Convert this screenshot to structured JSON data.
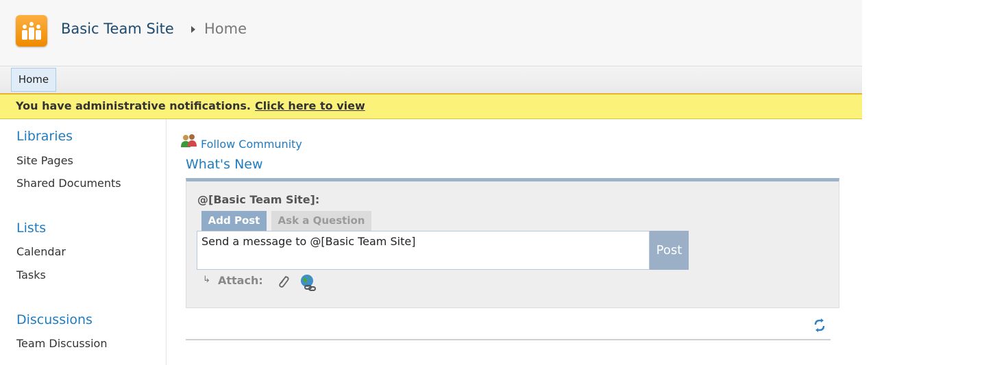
{
  "header": {
    "site_title": "Basic Team Site",
    "current_page": "Home"
  },
  "topnav": {
    "tabs": [
      {
        "label": "Home",
        "selected": true
      }
    ]
  },
  "notification": {
    "text": "You have administrative notifications.",
    "link": "Click here to view"
  },
  "leftnav": {
    "sections": [
      {
        "heading": "Libraries",
        "items": [
          "Site Pages",
          "Shared Documents"
        ]
      },
      {
        "heading": "Lists",
        "items": [
          "Calendar",
          "Tasks"
        ]
      },
      {
        "heading": "Discussions",
        "items": [
          "Team Discussion"
        ]
      }
    ]
  },
  "main": {
    "follow_label": "Follow Community",
    "section_title": "What's New",
    "composer": {
      "mention": "@[Basic Team Site]:",
      "tabs": [
        "Add Post",
        "Ask a Question"
      ],
      "active_tab": "Add Post",
      "message_placeholder": "Send a message to @[Basic Team Site]",
      "post_label": "Post",
      "attach_label": "Attach:"
    }
  },
  "icons": {
    "logo": "team-site-logo",
    "follow": "follow-people-icon",
    "attach_file": "paperclip-icon",
    "attach_link": "globe-link-icon",
    "refresh": "refresh-icon"
  },
  "colors": {
    "accent_blue": "#1f7cc0",
    "notification_bg": "#fbf27a",
    "post_button": "#9bb0c6",
    "active_tab": "#8fabc8",
    "logo_orange": "#f59b1d"
  }
}
